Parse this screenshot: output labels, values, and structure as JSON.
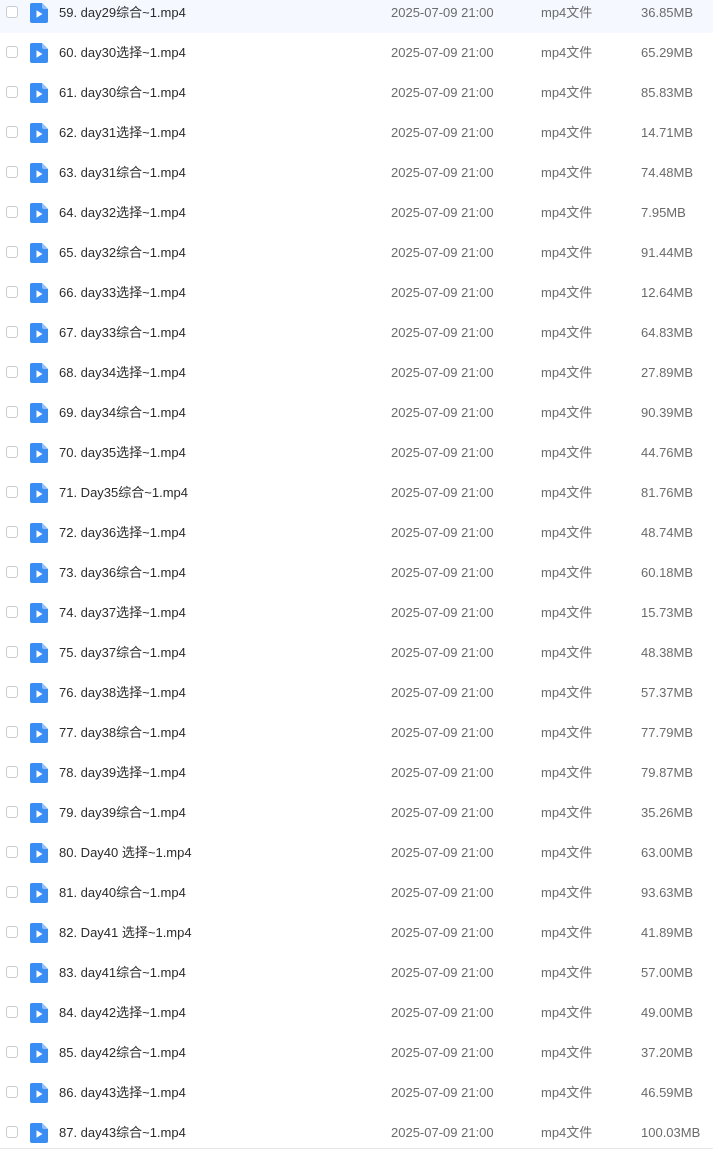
{
  "file_list": {
    "rows": [
      {
        "name": "59. day29综合~1.mp4",
        "date": "2025-07-09 21:00",
        "type": "mp4文件",
        "size": "36.85MB",
        "icon": "video-file-icon"
      },
      {
        "name": "60. day30选择~1.mp4",
        "date": "2025-07-09 21:00",
        "type": "mp4文件",
        "size": "65.29MB",
        "icon": "video-file-icon"
      },
      {
        "name": "61. day30综合~1.mp4",
        "date": "2025-07-09 21:00",
        "type": "mp4文件",
        "size": "85.83MB",
        "icon": "video-file-icon"
      },
      {
        "name": "62. day31选择~1.mp4",
        "date": "2025-07-09 21:00",
        "type": "mp4文件",
        "size": "14.71MB",
        "icon": "video-file-icon"
      },
      {
        "name": "63. day31综合~1.mp4",
        "date": "2025-07-09 21:00",
        "type": "mp4文件",
        "size": "74.48MB",
        "icon": "video-file-icon"
      },
      {
        "name": "64. day32选择~1.mp4",
        "date": "2025-07-09 21:00",
        "type": "mp4文件",
        "size": "7.95MB",
        "icon": "video-file-icon"
      },
      {
        "name": "65. day32综合~1.mp4",
        "date": "2025-07-09 21:00",
        "type": "mp4文件",
        "size": "91.44MB",
        "icon": "video-file-icon"
      },
      {
        "name": "66. day33选择~1.mp4",
        "date": "2025-07-09 21:00",
        "type": "mp4文件",
        "size": "12.64MB",
        "icon": "video-file-icon"
      },
      {
        "name": "67. day33综合~1.mp4",
        "date": "2025-07-09 21:00",
        "type": "mp4文件",
        "size": "64.83MB",
        "icon": "video-file-icon"
      },
      {
        "name": "68. day34选择~1.mp4",
        "date": "2025-07-09 21:00",
        "type": "mp4文件",
        "size": "27.89MB",
        "icon": "video-file-icon"
      },
      {
        "name": "69. day34综合~1.mp4",
        "date": "2025-07-09 21:00",
        "type": "mp4文件",
        "size": "90.39MB",
        "icon": "video-file-icon"
      },
      {
        "name": "70. day35选择~1.mp4",
        "date": "2025-07-09 21:00",
        "type": "mp4文件",
        "size": "44.76MB",
        "icon": "video-file-icon"
      },
      {
        "name": "71. Day35综合~1.mp4",
        "date": "2025-07-09 21:00",
        "type": "mp4文件",
        "size": "81.76MB",
        "icon": "video-file-icon"
      },
      {
        "name": "72. day36选择~1.mp4",
        "date": "2025-07-09 21:00",
        "type": "mp4文件",
        "size": "48.74MB",
        "icon": "video-file-icon"
      },
      {
        "name": "73. day36综合~1.mp4",
        "date": "2025-07-09 21:00",
        "type": "mp4文件",
        "size": "60.18MB",
        "icon": "video-file-icon"
      },
      {
        "name": "74. day37选择~1.mp4",
        "date": "2025-07-09 21:00",
        "type": "mp4文件",
        "size": "15.73MB",
        "icon": "video-file-icon"
      },
      {
        "name": "75. day37综合~1.mp4",
        "date": "2025-07-09 21:00",
        "type": "mp4文件",
        "size": "48.38MB",
        "icon": "video-file-icon"
      },
      {
        "name": "76. day38选择~1.mp4",
        "date": "2025-07-09 21:00",
        "type": "mp4文件",
        "size": "57.37MB",
        "icon": "video-file-icon"
      },
      {
        "name": "77. day38综合~1.mp4",
        "date": "2025-07-09 21:00",
        "type": "mp4文件",
        "size": "77.79MB",
        "icon": "video-file-icon"
      },
      {
        "name": "78. day39选择~1.mp4",
        "date": "2025-07-09 21:00",
        "type": "mp4文件",
        "size": "79.87MB",
        "icon": "video-file-icon"
      },
      {
        "name": "79. day39综合~1.mp4",
        "date": "2025-07-09 21:00",
        "type": "mp4文件",
        "size": "35.26MB",
        "icon": "video-file-icon"
      },
      {
        "name": "80. Day40 选择~1.mp4",
        "date": "2025-07-09 21:00",
        "type": "mp4文件",
        "size": "63.00MB",
        "icon": "video-file-icon"
      },
      {
        "name": "81. day40综合~1.mp4",
        "date": "2025-07-09 21:00",
        "type": "mp4文件",
        "size": "93.63MB",
        "icon": "video-file-icon"
      },
      {
        "name": "82. Day41 选择~1.mp4",
        "date": "2025-07-09 21:00",
        "type": "mp4文件",
        "size": "41.89MB",
        "icon": "video-file-icon"
      },
      {
        "name": "83. day41综合~1.mp4",
        "date": "2025-07-09 21:00",
        "type": "mp4文件",
        "size": "57.00MB",
        "icon": "video-file-icon"
      },
      {
        "name": "84. day42选择~1.mp4",
        "date": "2025-07-09 21:00",
        "type": "mp4文件",
        "size": "49.00MB",
        "icon": "video-file-icon"
      },
      {
        "name": "85. day42综合~1.mp4",
        "date": "2025-07-09 21:00",
        "type": "mp4文件",
        "size": "37.20MB",
        "icon": "video-file-icon"
      },
      {
        "name": "86. day43选择~1.mp4",
        "date": "2025-07-09 21:00",
        "type": "mp4文件",
        "size": "46.59MB",
        "icon": "video-file-icon"
      },
      {
        "name": "87. day43综合~1.mp4",
        "date": "2025-07-09 21:00",
        "type": "mp4文件",
        "size": "100.03MB",
        "icon": "video-file-icon"
      }
    ]
  },
  "colors": {
    "icon_blue": "#3a8ef3",
    "icon_blue_fold": "#8ec0fb",
    "text_primary": "#2b2b2b",
    "text_secondary": "#6b6b6b",
    "checkbox_border": "#c9ccd3"
  }
}
